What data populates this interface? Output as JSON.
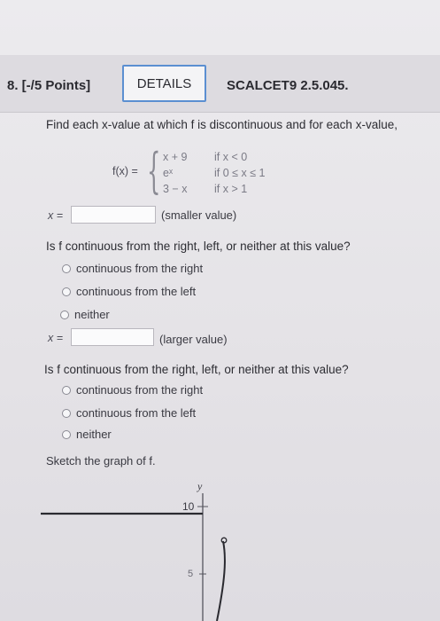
{
  "question": {
    "number": "8.  [-/5 Points]",
    "details_label": "DETAILS",
    "code": "SCALCET9 2.5.045."
  },
  "prompt": "Find each x-value at which f is discontinuous and for each x-value,",
  "function": {
    "label": "f(x) =",
    "cases": [
      {
        "expr": "x + 9",
        "cond": "if x < 0"
      },
      {
        "expr": "eˣ",
        "cond": "if 0 ≤ x ≤ 1"
      },
      {
        "expr": "3 − x",
        "cond": "if x > 1"
      }
    ]
  },
  "first": {
    "x_label": "x =",
    "value": "",
    "note": "(smaller value)",
    "question": "Is f continuous from the right, left, or neither at this value?",
    "options": [
      "continuous from the right",
      "continuous from the left",
      "neither"
    ]
  },
  "second": {
    "x_label": "x =",
    "value": "",
    "note": "(larger value)",
    "question": "Is f continuous from the right, left, or neither at this value?",
    "options": [
      "continuous from the right",
      "continuous from the left",
      "neither"
    ]
  },
  "sketch_label": "Sketch the graph of f.",
  "graph": {
    "y_axis_label": "y",
    "ticks": [
      "10",
      "5"
    ]
  }
}
